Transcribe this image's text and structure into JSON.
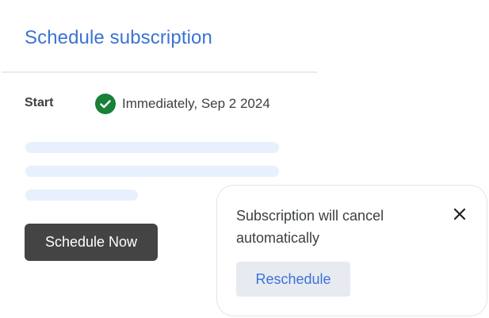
{
  "page": {
    "title": "Schedule subscription"
  },
  "start": {
    "label": "Start",
    "value": "Immediately, Sep 2 2024",
    "status_icon": "check-circle-icon",
    "status_color": "#188038"
  },
  "actions": {
    "schedule_label": "Schedule Now"
  },
  "toast": {
    "message": "Subscription will cancel automatically",
    "close_icon": "close-icon",
    "reschedule_label": "Reschedule"
  },
  "colors": {
    "accent": "#3b73d6",
    "button_dark": "#444444",
    "skeleton": "#e8f0fe"
  }
}
